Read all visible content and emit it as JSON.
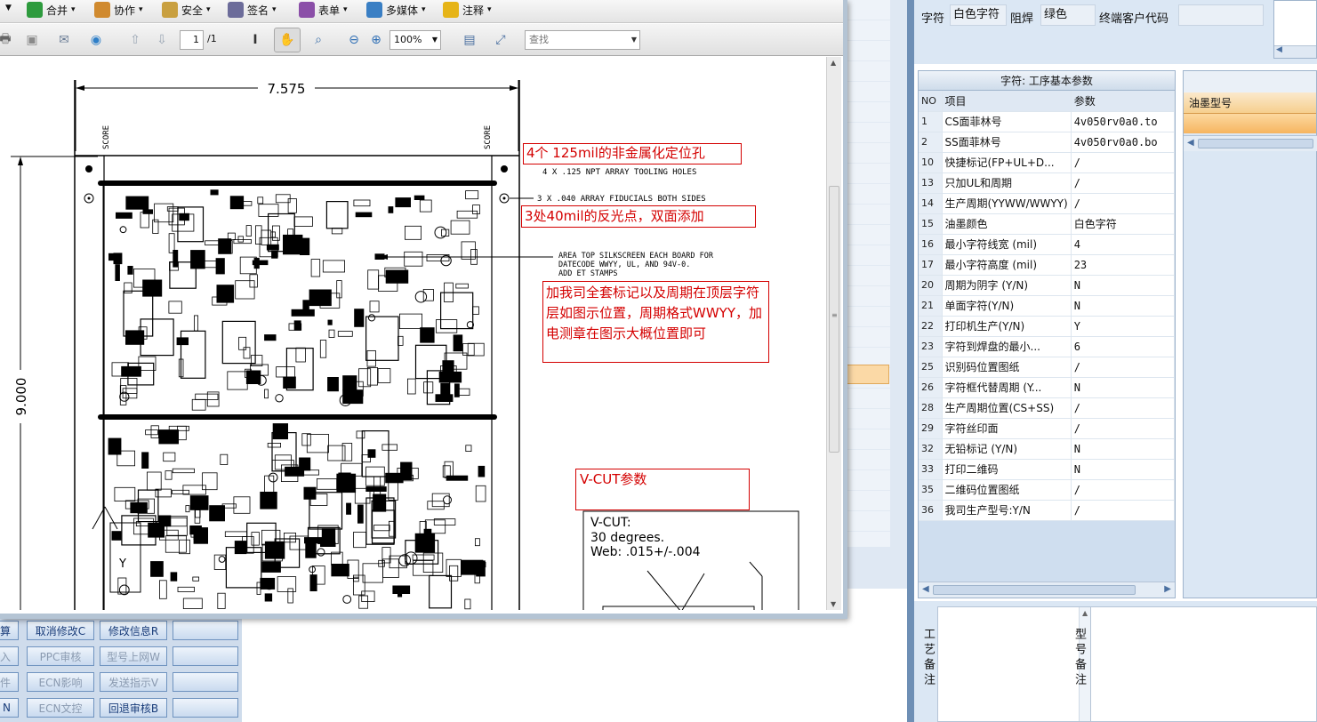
{
  "viewer": {
    "menu": [
      {
        "label": "合并",
        "icon": "merge-icon"
      },
      {
        "label": "协作",
        "icon": "collaborate-icon"
      },
      {
        "label": "安全",
        "icon": "lock-icon"
      },
      {
        "label": "签名",
        "icon": "pen-icon"
      },
      {
        "label": "表单",
        "icon": "form-icon"
      },
      {
        "label": "多媒体",
        "icon": "multimedia-icon"
      },
      {
        "label": "注释",
        "icon": "comment-icon"
      }
    ],
    "page_current": "1",
    "page_total": "/1",
    "zoom": "100%",
    "search_placeholder": "查找"
  },
  "drawing": {
    "width_dim": "7.575",
    "height_dim": "9.000",
    "score_left": "SCORE",
    "score_right": "SCORE",
    "note_tooling": "4 X .125 NPT ARRAY TOOLING HOLES",
    "note_fiducials": "3 X .040 ARRAY FIDUCIALS BOTH SIDES",
    "note_area": [
      "AREA TOP SILKSCREEN EACH BOARD FOR",
      "DATECODE WWYY, UL, AND 94V-0.",
      "ADD ET STAMPS"
    ],
    "vcut": [
      "V-CUT:",
      "30 degrees.",
      "Web: .015+/-.004"
    ]
  },
  "annotations": {
    "tooling_cn": "4个 125mil的非金属化定位孔",
    "fiducial_cn": "3处40mil的反光点，双面添加",
    "marking_cn": "加我司全套标记以及周期在顶层字符层如图示位置，周期格式WWYY，加电测章在图示大概位置即可",
    "vcut_cn": "V-CUT参数"
  },
  "top_fields": {
    "zifu_label": "字符",
    "zifu_value": "白色字符",
    "zuhan_label": "阻焊",
    "zuhan_value": "绿色",
    "customer_code_label": "终端客户代码",
    "customer_code_value": ""
  },
  "params_panel": {
    "title": "字符: 工序基本参数",
    "col_no": "NO",
    "col_item": "项目",
    "col_param": "参数",
    "rows": [
      {
        "no": "1",
        "item": "CS面菲林号",
        "param": "4v050rv0a0.to"
      },
      {
        "no": "2",
        "item": "SS面菲林号",
        "param": "4v050rv0a0.bo"
      },
      {
        "no": "10",
        "item": "快捷标记(FP+UL+D...",
        "param": "/"
      },
      {
        "no": "13",
        "item": "只加UL和周期",
        "param": "/"
      },
      {
        "no": "14",
        "item": "生产周期(YYWW/WWYY)",
        "param": "/"
      },
      {
        "no": "15",
        "item": "油墨颜色",
        "param": "白色字符"
      },
      {
        "no": "16",
        "item": "最小字符线宽 (mil)",
        "param": "4"
      },
      {
        "no": "17",
        "item": "最小字符高度 (mil)",
        "param": "23"
      },
      {
        "no": "20",
        "item": "周期为阴字 (Y/N)",
        "param": "N"
      },
      {
        "no": "21",
        "item": "单面字符(Y/N)",
        "param": "N"
      },
      {
        "no": "22",
        "item": "打印机生产(Y/N)",
        "param": "Y"
      },
      {
        "no": "23",
        "item": "字符到焊盘的最小...",
        "param": "6"
      },
      {
        "no": "25",
        "item": "识别码位置图纸",
        "param": "/"
      },
      {
        "no": "26",
        "item": "字符框代替周期 (Y...",
        "param": "N"
      },
      {
        "no": "28",
        "item": "生产周期位置(CS+SS)",
        "param": "/"
      },
      {
        "no": "29",
        "item": "字符丝印面",
        "param": "/"
      },
      {
        "no": "32",
        "item": "无铅标记 (Y/N)",
        "param": "N"
      },
      {
        "no": "33",
        "item": "打印二维码",
        "param": "N"
      },
      {
        "no": "35",
        "item": "二维码位置图纸",
        "param": "/"
      },
      {
        "no": "36",
        "item": "我司生产型号:Y/N",
        "param": "/"
      }
    ]
  },
  "ink_panel": {
    "header": "油墨型号"
  },
  "remarks": {
    "process_label": "工艺备注",
    "model_label": "型号备注"
  },
  "bottom_buttons": [
    {
      "label": "算",
      "disabled": false
    },
    {
      "label": "取消修改C",
      "disabled": false
    },
    {
      "label": "修改信息R",
      "disabled": false
    },
    {
      "label": "",
      "disabled": false
    },
    {
      "label": "入",
      "disabled": true
    },
    {
      "label": "PPC审核",
      "disabled": true
    },
    {
      "label": "型号上网W",
      "disabled": true
    },
    {
      "label": "",
      "disabled": false
    },
    {
      "label": "件",
      "disabled": true
    },
    {
      "label": "ECN影响",
      "disabled": true
    },
    {
      "label": "发送指示V",
      "disabled": true
    },
    {
      "label": "",
      "disabled": false
    },
    {
      "label": "N",
      "disabled": false
    },
    {
      "label": "ECN文控",
      "disabled": true
    },
    {
      "label": "回退审核B",
      "disabled": false
    },
    {
      "label": "",
      "disabled": false
    }
  ]
}
